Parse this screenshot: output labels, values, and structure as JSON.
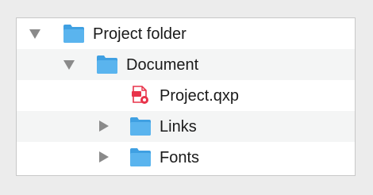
{
  "tree": {
    "items": [
      {
        "label": "Project folder",
        "type": "folder",
        "expanded": true,
        "icon": "folder-icon"
      },
      {
        "label": "Document",
        "type": "folder",
        "expanded": true,
        "icon": "folder-icon"
      },
      {
        "label": "Project.qxp",
        "type": "file",
        "icon": "quarkxpress-file-icon"
      },
      {
        "label": "Links",
        "type": "folder",
        "expanded": false,
        "icon": "folder-icon"
      },
      {
        "label": "Fonts",
        "type": "folder",
        "expanded": false,
        "icon": "folder-icon"
      }
    ]
  },
  "colors": {
    "folder_blue": "#5ab4ee",
    "folder_blue_dark": "#3fa0e2",
    "file_red": "#e8334a",
    "disclosure_gray": "#8a8a8a"
  }
}
